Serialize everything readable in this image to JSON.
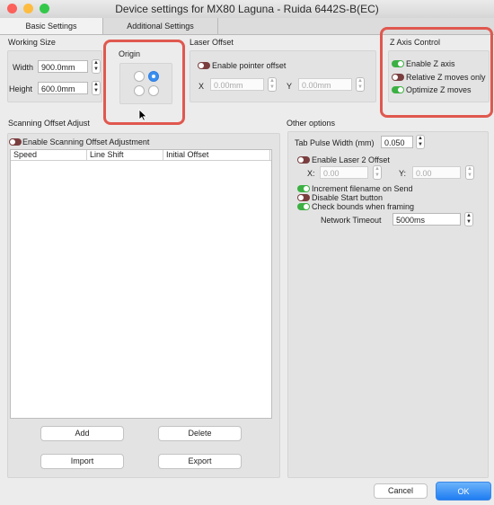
{
  "window": {
    "title": "Device settings for MX80 Laguna - Ruida 6442S-B(EC)"
  },
  "tabs": [
    {
      "label": "Basic Settings",
      "active": true
    },
    {
      "label": "Additional Settings",
      "active": false
    }
  ],
  "working_size": {
    "title": "Working Size",
    "width_label": "Width",
    "width_value": "900.0mm",
    "height_label": "Height",
    "height_value": "600.0mm"
  },
  "origin": {
    "title": "Origin",
    "selected": "top-right"
  },
  "laser_offset": {
    "title": "Laser Offset",
    "enable_label": "Enable pointer offset",
    "enabled": false,
    "x_label": "X",
    "x_value": "0.00mm",
    "y_label": "Y",
    "y_value": "0.00mm"
  },
  "z_axis": {
    "title": "Z Axis Control",
    "items": [
      {
        "label": "Enable Z axis",
        "on": true
      },
      {
        "label": "Relative Z moves only",
        "on": false
      },
      {
        "label": "Optimize Z moves",
        "on": true
      }
    ]
  },
  "scanning": {
    "title": "Scanning Offset Adjust",
    "enable_label": "Enable Scanning Offset Adjustment",
    "enabled": false,
    "columns": [
      "Speed",
      "Line Shift",
      "Initial Offset"
    ],
    "buttons": {
      "add": "Add",
      "delete": "Delete",
      "import": "Import",
      "export": "Export"
    }
  },
  "other": {
    "title": "Other options",
    "tab_pulse_label": "Tab Pulse Width (mm)",
    "tab_pulse_value": "0.050",
    "laser2_label": "Enable Laser 2 Offset",
    "laser2_on": false,
    "x_label": "X:",
    "x_value": "0.00",
    "y_label": "Y:",
    "y_value": "0.00",
    "increment_label": "Increment filename on Send",
    "increment_on": true,
    "disable_start_label": "Disable Start button",
    "disable_start_on": false,
    "check_bounds_label": "Check bounds when framing",
    "check_bounds_on": true,
    "network_timeout_label": "Network Timeout",
    "network_timeout_value": "5000ms"
  },
  "footer": {
    "cancel": "Cancel",
    "ok": "OK"
  },
  "colors": {
    "toggle_on": "#3cb043",
    "toggle_off": "#7a3e3e",
    "accent": "#3a8ef0",
    "highlight": "#e0584f"
  }
}
